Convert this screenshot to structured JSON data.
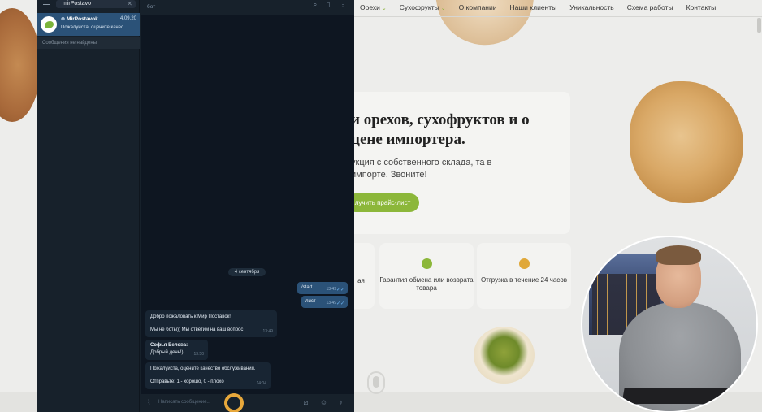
{
  "website": {
    "nav": [
      {
        "label": "Орехи",
        "has_chevron": true
      },
      {
        "label": "Сухофрукты",
        "has_chevron": true
      },
      {
        "label": "О компании",
        "has_chevron": false
      },
      {
        "label": "Наши клиенты",
        "has_chevron": false
      },
      {
        "label": "Уникальность",
        "has_chevron": false
      },
      {
        "label": "Схема работы",
        "has_chevron": false
      },
      {
        "label": "Контакты",
        "has_chevron": false
      }
    ],
    "hero_title": "и орехов, сухофруктов и о цене импортера.",
    "hero_subtitle": "укция с собственного склада, та в импорте. Звоните!",
    "hero_button": "лучить прайс-лист",
    "features": [
      {
        "text": "ая",
        "dot_color": ""
      },
      {
        "text": "Гарантия обмена или возврата товара",
        "dot_color": "#8cb73a"
      },
      {
        "text": "Отгрузка в течение 24 часов",
        "dot_color": "#e0a83a"
      }
    ],
    "accent_color": "#8cb73a"
  },
  "messenger": {
    "search_value": "mirPostavo",
    "chat": {
      "name": "MirPostavok",
      "date": "4.09.20",
      "preview": "Пожалуйста, оцените качес..."
    },
    "no_messages": "Сообщения не найдены",
    "header_label": "бот",
    "date_divider": "4 сентября",
    "outgoing": [
      {
        "text": "/start",
        "time": "13:49"
      },
      {
        "text": "лист",
        "time": "13:49"
      }
    ],
    "incoming": [
      {
        "lines": [
          "Добро пожаловать к Мир Поставок!",
          "Мы не боты)) Мы ответим на ваш вопрос"
        ],
        "time": "13:49"
      },
      {
        "lines": [
          "Софья Белова:",
          "Добрый день!)"
        ],
        "time": "13:50"
      },
      {
        "lines": [
          "Пожалуйста, оцените качество обслуживания.",
          "Отправьте: 1 - хорошо, 0 - плохо"
        ],
        "time": "14:04"
      }
    ],
    "input_placeholder": "Написать сообщение...",
    "ticks": "✓✓"
  }
}
